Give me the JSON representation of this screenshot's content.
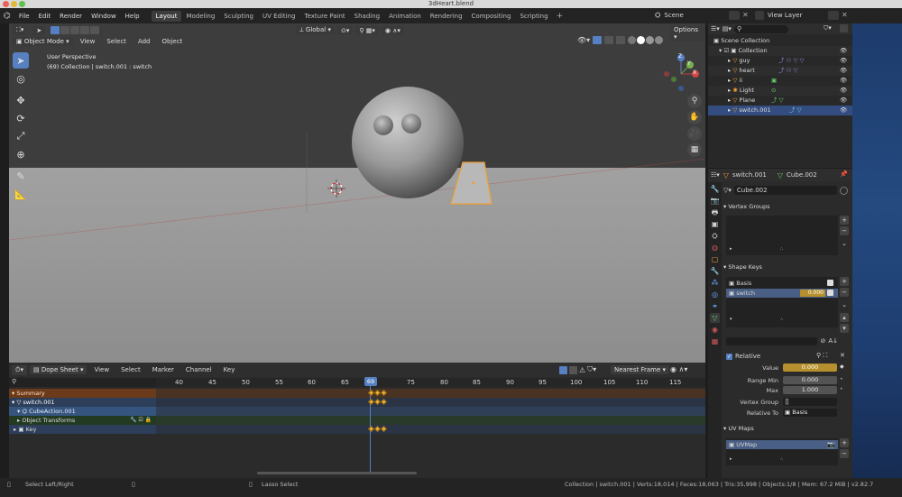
{
  "window": {
    "title": "3dHeart.blend"
  },
  "menu": {
    "items": [
      "File",
      "Edit",
      "Render",
      "Window",
      "Help"
    ]
  },
  "workspaces": [
    "Layout",
    "Modeling",
    "Sculpting",
    "UV Editing",
    "Texture Paint",
    "Shading",
    "Animation",
    "Rendering",
    "Compositing",
    "Scripting"
  ],
  "scene": {
    "label": "Scene",
    "view_layer": "View Layer"
  },
  "viewport": {
    "mode": "Object Mode",
    "menus": [
      "View",
      "Select",
      "Add",
      "Object"
    ],
    "transform": "Global",
    "options": "Options",
    "info_line1": "User Perspective",
    "info_line2": "(69) Collection | switch.001 : switch",
    "gizmo": {
      "z": "Z",
      "y": "Y",
      "x": "X"
    }
  },
  "dopesheet": {
    "mode": "Dope Sheet",
    "menus": [
      "View",
      "Select",
      "Marker",
      "Channel",
      "Key"
    ],
    "interp": "Nearest Frame",
    "current_frame": "69",
    "frames": [
      "40",
      "45",
      "50",
      "55",
      "60",
      "65",
      "75",
      "80",
      "85",
      "90",
      "95",
      "100",
      "105",
      "110",
      "115"
    ],
    "channels": [
      "Summary",
      "switch.001",
      "CubeAction.001",
      "Object Transforms",
      "Key"
    ]
  },
  "outliner": {
    "root": "Scene Collection",
    "collection": "Collection",
    "items": [
      "guy",
      "heart",
      "ii",
      "Light",
      "Plane",
      "switch.001"
    ]
  },
  "properties": {
    "object": "switch.001",
    "mesh": "Cube.002",
    "mesh_field": "Cube.002",
    "vertex_groups": "Vertex Groups",
    "shape_keys": "Shape Keys",
    "keys": [
      {
        "name": "Basis",
        "value": ""
      },
      {
        "name": "switch",
        "value": "0.000"
      }
    ],
    "relative": "Relative",
    "value_label": "Value",
    "value": "0.000",
    "range_min_label": "Range Min",
    "range_min": "0.000",
    "max_label": "Max",
    "max": "1.000",
    "vertex_group_label": "Vertex Group",
    "relative_to_label": "Relative To",
    "relative_to": "Basis",
    "uv_maps": "UV Maps",
    "uv_map": "UVMap"
  },
  "status": {
    "left": "Select Left/Right",
    "mid": "Lasso Select",
    "right": "Collection | switch.001 | Verts:18,014 | Faces:18,063 | Tris:35,998 | Objects:1/8 | Mem: 67.2 MiB | v2.82.7"
  },
  "colors": {
    "accent": "#5680c2",
    "keyframe": "#f0b43a",
    "selected": "#334d80"
  }
}
